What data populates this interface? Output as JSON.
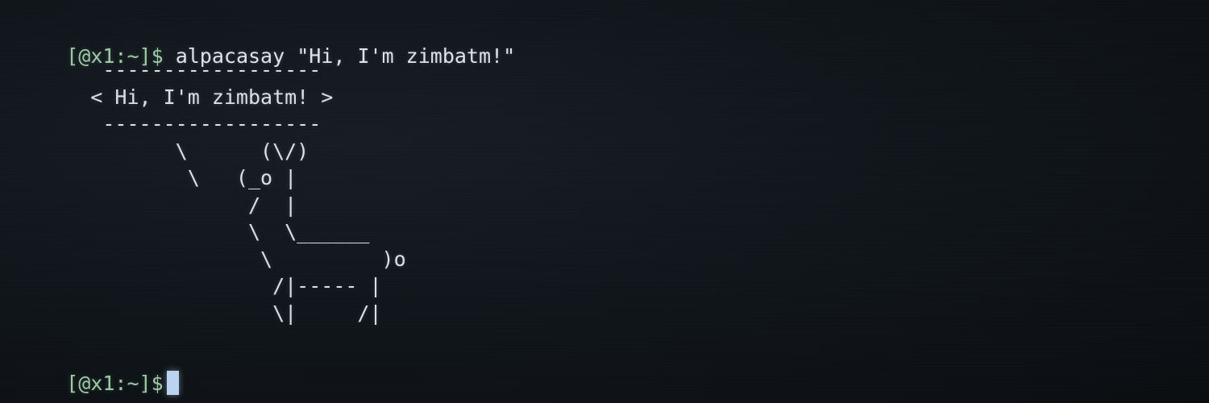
{
  "terminal": {
    "prompt": "[@x1:~]$",
    "command": "alpacasay \"Hi, I'm zimbatm!\"",
    "output": "       ------------------\n      < Hi, I'm zimbatm! >\n       ------------------\n             \\      (\\/)\n              \\   (_o |\n                   /  |\n                   \\  \\______\n                    \\         )o\n                     /|----- |\n                     \\|     /|",
    "second_prompt": "[@x1:~]$"
  },
  "colors": {
    "background": "#0c1014",
    "prompt": "#9fc9a8",
    "text": "#dbe4ea",
    "cursor": "#b9d3f0"
  }
}
